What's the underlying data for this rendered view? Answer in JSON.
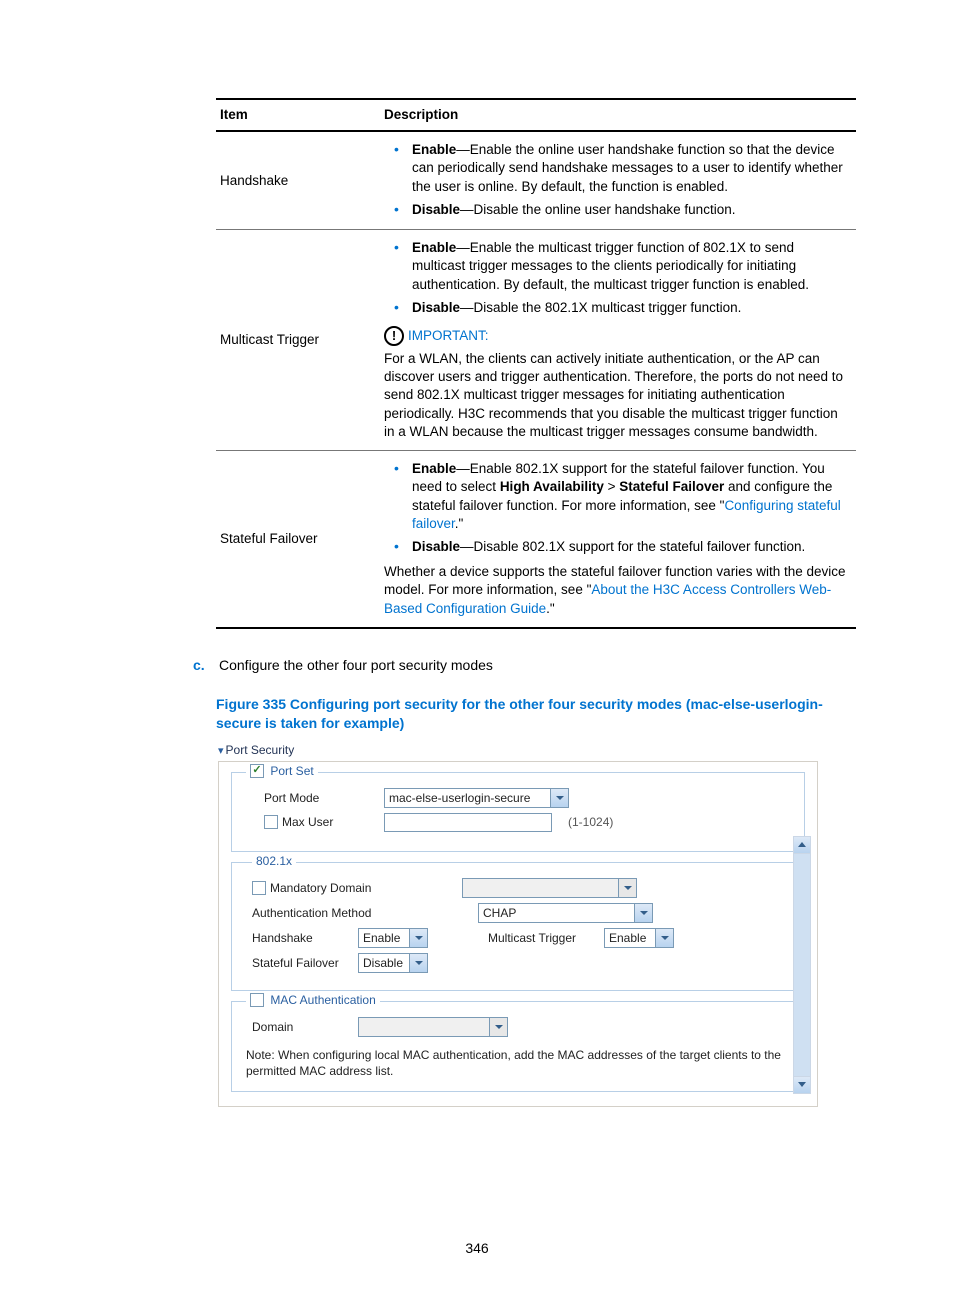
{
  "table": {
    "headers": {
      "item": "Item",
      "description": "Description"
    },
    "rows": [
      {
        "item": "Handshake",
        "enable": {
          "lead": "Enable",
          "text": "—Enable the online user handshake function so that the device can periodically send handshake messages to a user to identify whether the user is online. By default, the function is enabled."
        },
        "disable": {
          "lead": "Disable",
          "text": "—Disable the online user handshake function."
        }
      },
      {
        "item": "Multicast Trigger",
        "enable": {
          "lead": "Enable",
          "text": "—Enable the multicast trigger function of 802.1X to send multicast trigger messages to the clients periodically for initiating authentication. By default, the multicast trigger function is enabled."
        },
        "disable": {
          "lead": "Disable",
          "text": "—Disable the 802.1X multicast trigger function."
        },
        "important_label": "IMPORTANT:",
        "important_body": "For a WLAN, the clients can actively initiate authentication, or the AP can discover users and trigger authentication. Therefore, the ports do not need to send 802.1X multicast trigger messages for initiating authentication periodically. H3C recommends that you disable the multicast trigger function in a WLAN because the multicast trigger messages consume bandwidth."
      },
      {
        "item": "Stateful Failover",
        "enable": {
          "lead": "Enable",
          "pre_text": "—Enable 802.1X support for the stateful failover function. You need to select ",
          "path1": "High Availability",
          "gt": " > ",
          "path2": "Stateful Failover",
          "mid_text": " and configure the stateful failover function. For more information, see \"",
          "link": "Configuring stateful failover",
          "post_text": ".\""
        },
        "disable": {
          "lead": "Disable",
          "text": "—Disable 802.1X support for the stateful failover function."
        },
        "footer": {
          "pre": "Whether a device supports the stateful failover function varies with the device model. For more information, see \"",
          "link": "About the H3C Access Controllers Web-Based Configuration Guide",
          "post": ".\""
        }
      }
    ]
  },
  "step": {
    "marker": "c.",
    "text": "Configure the other four port security modes"
  },
  "figure": {
    "caption": "Figure 335 Configuring port security for the other four security modes (mac-else-userlogin-secure is taken for example)"
  },
  "ui": {
    "section_title": "Port Security",
    "portset_legend": "Port Set",
    "port_mode_label": "Port Mode",
    "port_mode_value": "mac-else-userlogin-secure",
    "max_user_label": "Max User",
    "max_user_hint": "(1-1024)",
    "dot1x_legend": "802.1x",
    "mandatory_domain_label": "Mandatory Domain",
    "auth_method_label": "Authentication Method",
    "auth_method_value": "CHAP",
    "handshake_label": "Handshake",
    "handshake_value": "Enable",
    "mcast_label": "Multicast Trigger",
    "mcast_value": "Enable",
    "sf_label": "Stateful Failover",
    "sf_value": "Disable",
    "macauth_legend": "MAC Authentication",
    "domain_label": "Domain",
    "note_text": "Note: When configuring local MAC authentication, add the MAC addresses of the target clients to the permitted MAC address list."
  },
  "page_number": "346"
}
